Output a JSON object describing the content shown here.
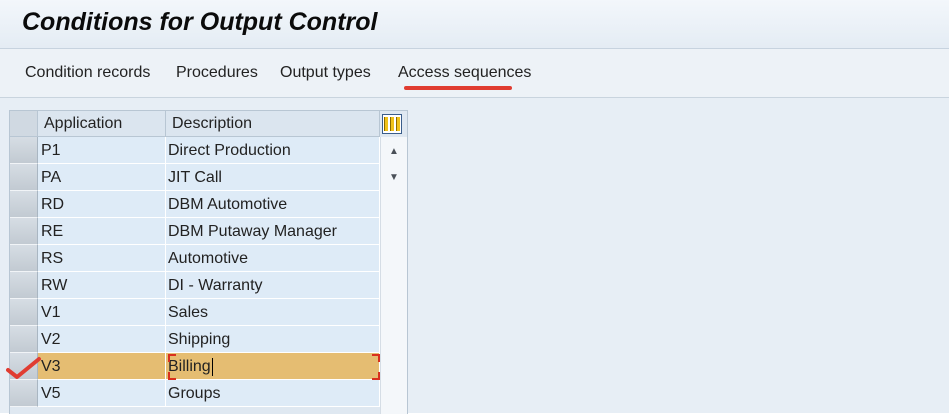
{
  "window": {
    "title": "Conditions for Output Control"
  },
  "menu": {
    "items": [
      {
        "label": "Condition records"
      },
      {
        "label": "Procedures"
      },
      {
        "label": "Output types"
      },
      {
        "label": "Access sequences"
      }
    ],
    "highlighted": "Access sequences"
  },
  "table": {
    "columns": [
      "Application",
      "Description"
    ],
    "rows": [
      {
        "application": "P1",
        "description": "Direct Production"
      },
      {
        "application": "PA",
        "description": "JIT Call"
      },
      {
        "application": "RD",
        "description": "DBM Automotive"
      },
      {
        "application": "RE",
        "description": "DBM Putaway Manager"
      },
      {
        "application": "RS",
        "description": "Automotive"
      },
      {
        "application": "RW",
        "description": "DI - Warranty"
      },
      {
        "application": "V1",
        "description": "Sales"
      },
      {
        "application": "V2",
        "description": "Shipping"
      },
      {
        "application": "V3",
        "description": "Billing"
      },
      {
        "application": "V5",
        "description": "Groups"
      }
    ],
    "selected_row": "V3"
  },
  "colors": {
    "selected_row": "#e5bd72",
    "annotation": "#e03c31",
    "row_background": "#deebf7"
  },
  "icons": [
    "column-settings-icon",
    "scroll-up-icon",
    "scroll-down-icon",
    "checkmark-annotation-icon"
  ]
}
